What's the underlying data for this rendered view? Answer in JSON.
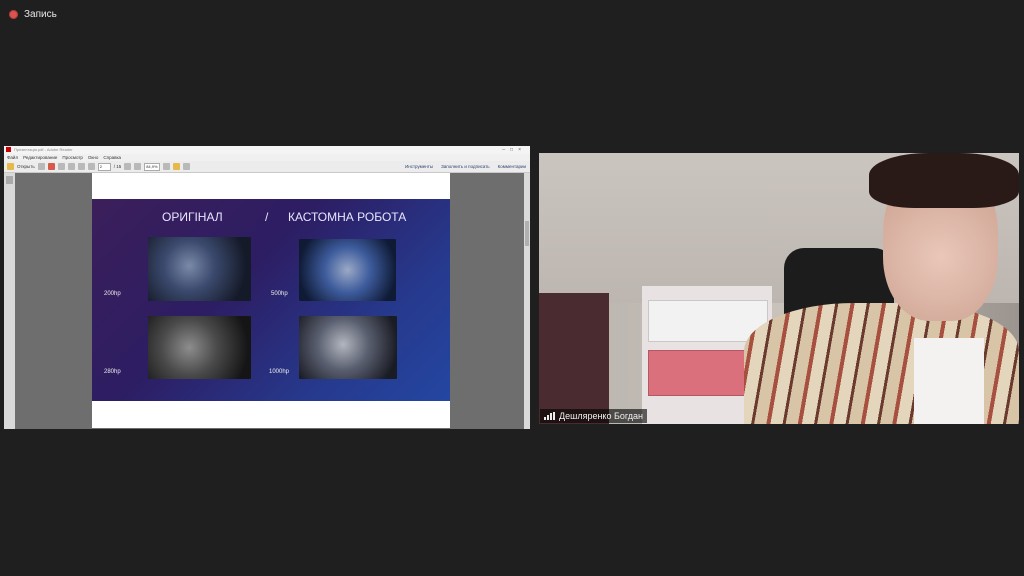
{
  "recording": {
    "label": "Запись"
  },
  "pdf_window": {
    "title": "Презентація.pdf - Adobe Reader",
    "menu": [
      "Файл",
      "Редактирование",
      "Просмотр",
      "Окно",
      "Справка"
    ],
    "toolbar": {
      "open_label": "Открыть",
      "page_current": "2",
      "page_total": "/ 15",
      "zoom": "84,9%",
      "tools_label": "Инструменты",
      "sign_label": "Заполнить и подписать",
      "comment_label": "Комментарии"
    }
  },
  "slide": {
    "title_left": "ОРИГІНАЛ",
    "title_sep": "/",
    "title_right": "КАСТОМНА РОБОТА",
    "hp": [
      "200hp",
      "500hp",
      "280hp",
      "1000hp"
    ]
  },
  "participant": {
    "name": "Дешляренко Богдан"
  }
}
